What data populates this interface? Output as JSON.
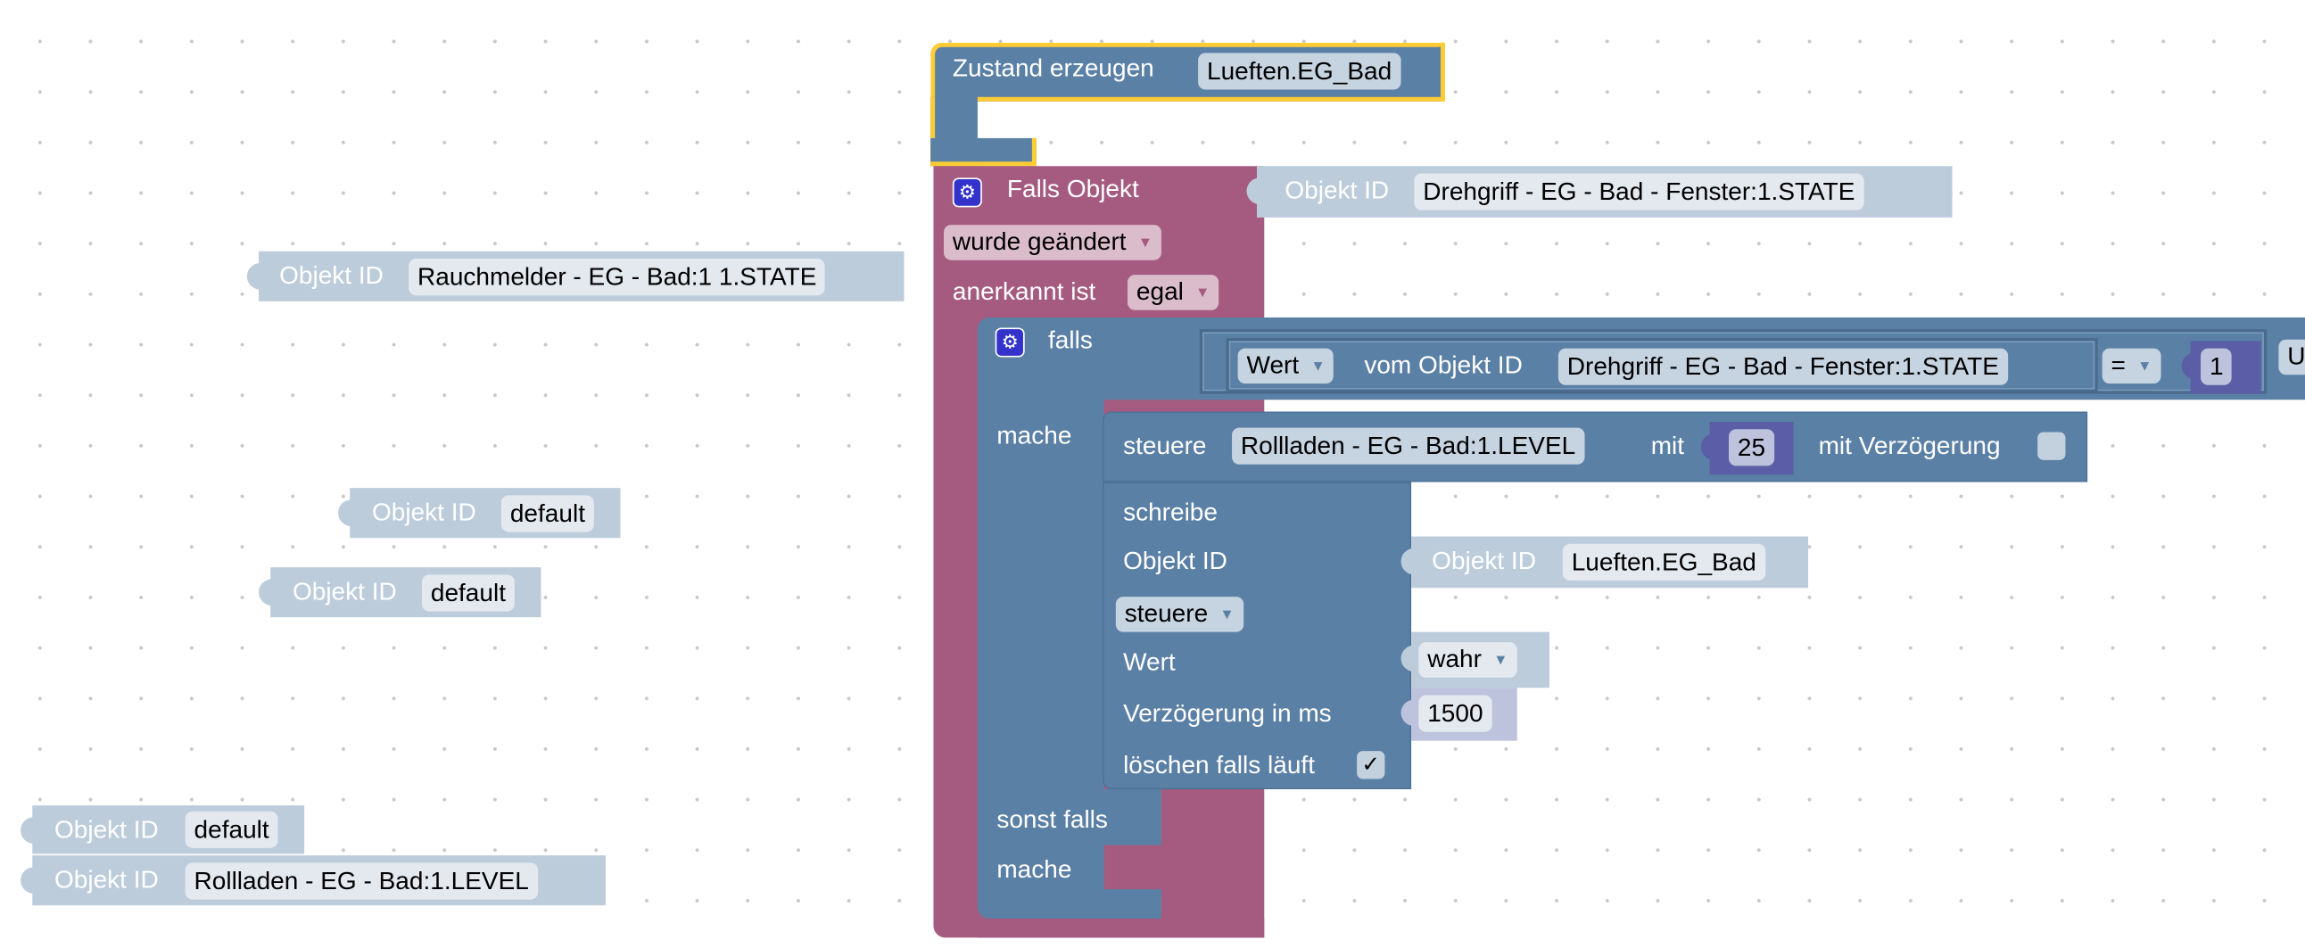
{
  "colors": {
    "event_block": "#a55b80",
    "logic_block": "#5b80a5",
    "value_block": "#bdccdb",
    "math_block": "#5b5ea6",
    "selected_outline": "#ffcc33"
  },
  "create_state": {
    "label": "Zustand erzeugen",
    "name": "Lueften.EG_Bad"
  },
  "trigger": {
    "label": "Falls Objekt",
    "object_label": "Objekt ID",
    "object_id": "Drehgriff - EG - Bad - Fenster:1.STATE",
    "condition": "wurde geändert",
    "ack_label": "anerkannt ist",
    "ack_value": "egal"
  },
  "if_block": {
    "if_label": "falls",
    "compare": {
      "mode": "Wert",
      "from_label": "vom Objekt ID",
      "object_id": "Drehgriff - EG - Bad - Fenster:1.STATE",
      "operator": "=",
      "value": "1",
      "trailing": "U"
    },
    "do_label": "mache",
    "elseif_label": "sonst falls",
    "do2_label": "mache",
    "control": {
      "label": "steuere",
      "object_id": "Rollladen - EG - Bad:1.LEVEL",
      "with_label": "mit",
      "value": "25",
      "delay_label": "mit Verzögerung",
      "delay_checked": false
    },
    "write": {
      "label": "schreibe",
      "object_label": "Objekt ID",
      "object_block_label": "Objekt ID",
      "object_id": "Lueften.EG_Bad",
      "mode": "steuere",
      "value_label": "Wert",
      "value": "wahr",
      "delay_label": "Verzögerung in ms",
      "delay": "1500",
      "clear_label": "löschen falls läuft",
      "clear_checked": true,
      "check_glyph": "✓"
    }
  },
  "loose_blocks": [
    {
      "label": "Objekt ID",
      "value": "Rauchmelder - EG - Bad:1 1.STATE"
    },
    {
      "label": "Objekt ID",
      "value": "default"
    },
    {
      "label": "Objekt ID",
      "value": "default"
    },
    {
      "label": "Objekt ID",
      "value": "default"
    },
    {
      "label": "Objekt ID",
      "value": "Rollladen - EG - Bad:1.LEVEL"
    }
  ]
}
